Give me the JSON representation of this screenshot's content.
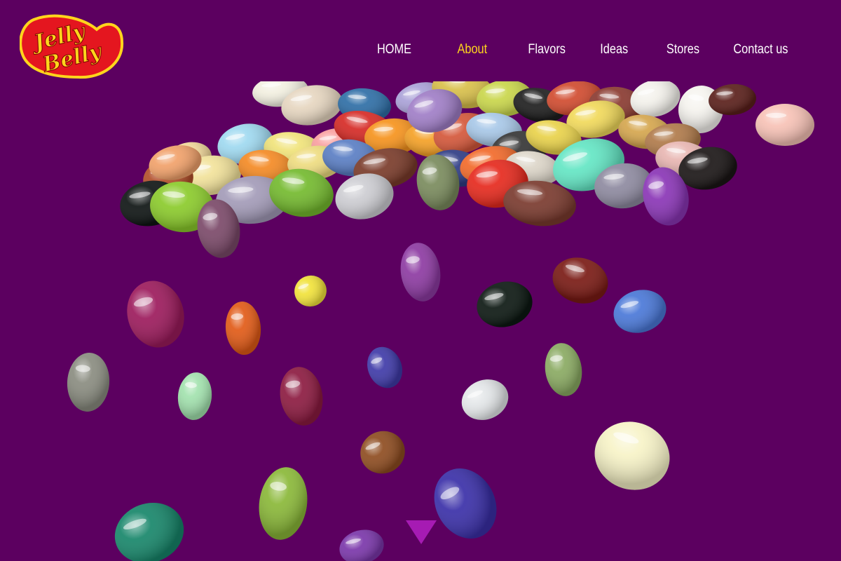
{
  "brand": {
    "logo_text_line1": "Jelly",
    "logo_text_line2": "Belly",
    "logo_color_red": "#e4161f",
    "logo_color_yellow": "#ffd51c"
  },
  "nav": {
    "items": [
      {
        "label": "HOME",
        "active": false
      },
      {
        "label": "About",
        "active": true
      },
      {
        "label": "Flavors",
        "active": false
      },
      {
        "label": "Ideas",
        "active": false
      },
      {
        "label": "Stores",
        "active": false
      },
      {
        "label": "Contact us",
        "active": false
      }
    ],
    "active_color": "#ffd51c",
    "text_color": "#ffffff"
  },
  "theme": {
    "background": "#5c0060",
    "arrow_color": "#a61bb3"
  },
  "hero": {
    "image": "pile-of-jelly-beans-falling"
  }
}
